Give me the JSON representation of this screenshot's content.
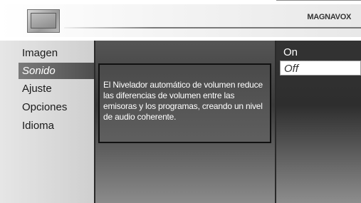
{
  "header": {
    "brand": "MAGNAVOX",
    "icon": "tv-icon"
  },
  "menu": {
    "items": [
      {
        "label": "Imagen",
        "selected": false
      },
      {
        "label": "Sonido",
        "selected": true
      },
      {
        "label": "Ajuste",
        "selected": false
      },
      {
        "label": "Opciones",
        "selected": false
      },
      {
        "label": "Idioma",
        "selected": false
      }
    ]
  },
  "info": {
    "text": "El Nivelador automático de volumen reduce las diferencias de volumen entre las emisoras y los programas, creando un nivel de audio coherente."
  },
  "options": {
    "items": [
      {
        "label": "On",
        "selected": false
      },
      {
        "label": "Off",
        "selected": true
      }
    ]
  },
  "colors": {
    "highlight": "#5e5e5e",
    "panel_dark": "#3a3a3a",
    "text_light": "#ffffff"
  }
}
